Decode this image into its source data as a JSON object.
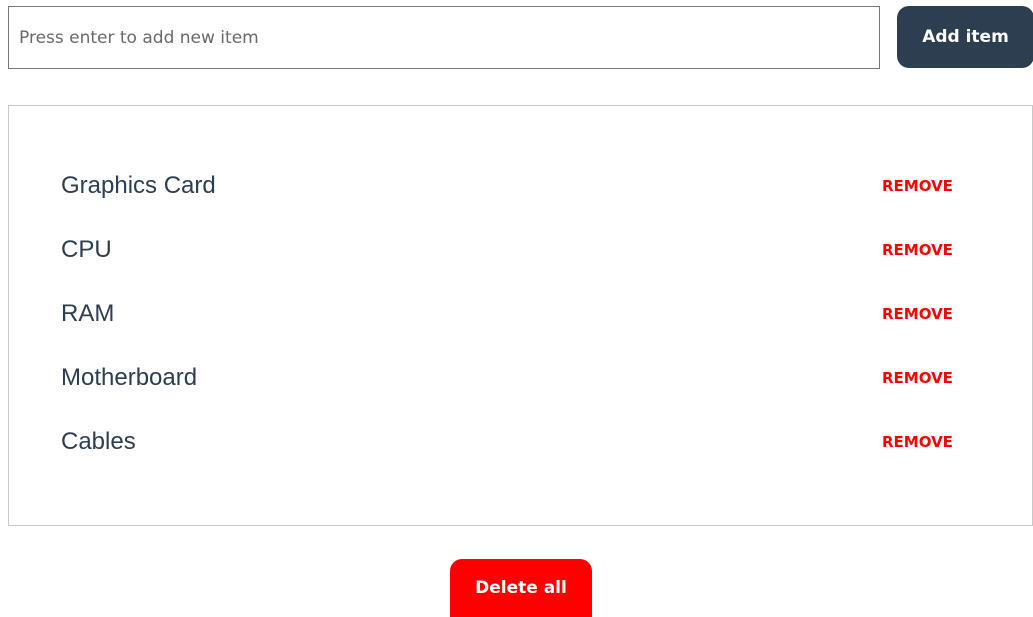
{
  "new_item": {
    "placeholder": "Press enter to add new item",
    "value": ""
  },
  "toolbar": {
    "add_label": "Add item"
  },
  "items": [
    {
      "name": "Graphics Card",
      "remove_label": "REMOVE"
    },
    {
      "name": "CPU",
      "remove_label": "REMOVE"
    },
    {
      "name": "RAM",
      "remove_label": "REMOVE"
    },
    {
      "name": "Motherboard",
      "remove_label": "REMOVE"
    },
    {
      "name": "Cables",
      "remove_label": "REMOVE"
    }
  ],
  "footer": {
    "delete_all_label": "Delete all"
  },
  "colors": {
    "add_button": "#2c3e50",
    "danger": "#ff0000",
    "item_text": "#2c3e50"
  }
}
